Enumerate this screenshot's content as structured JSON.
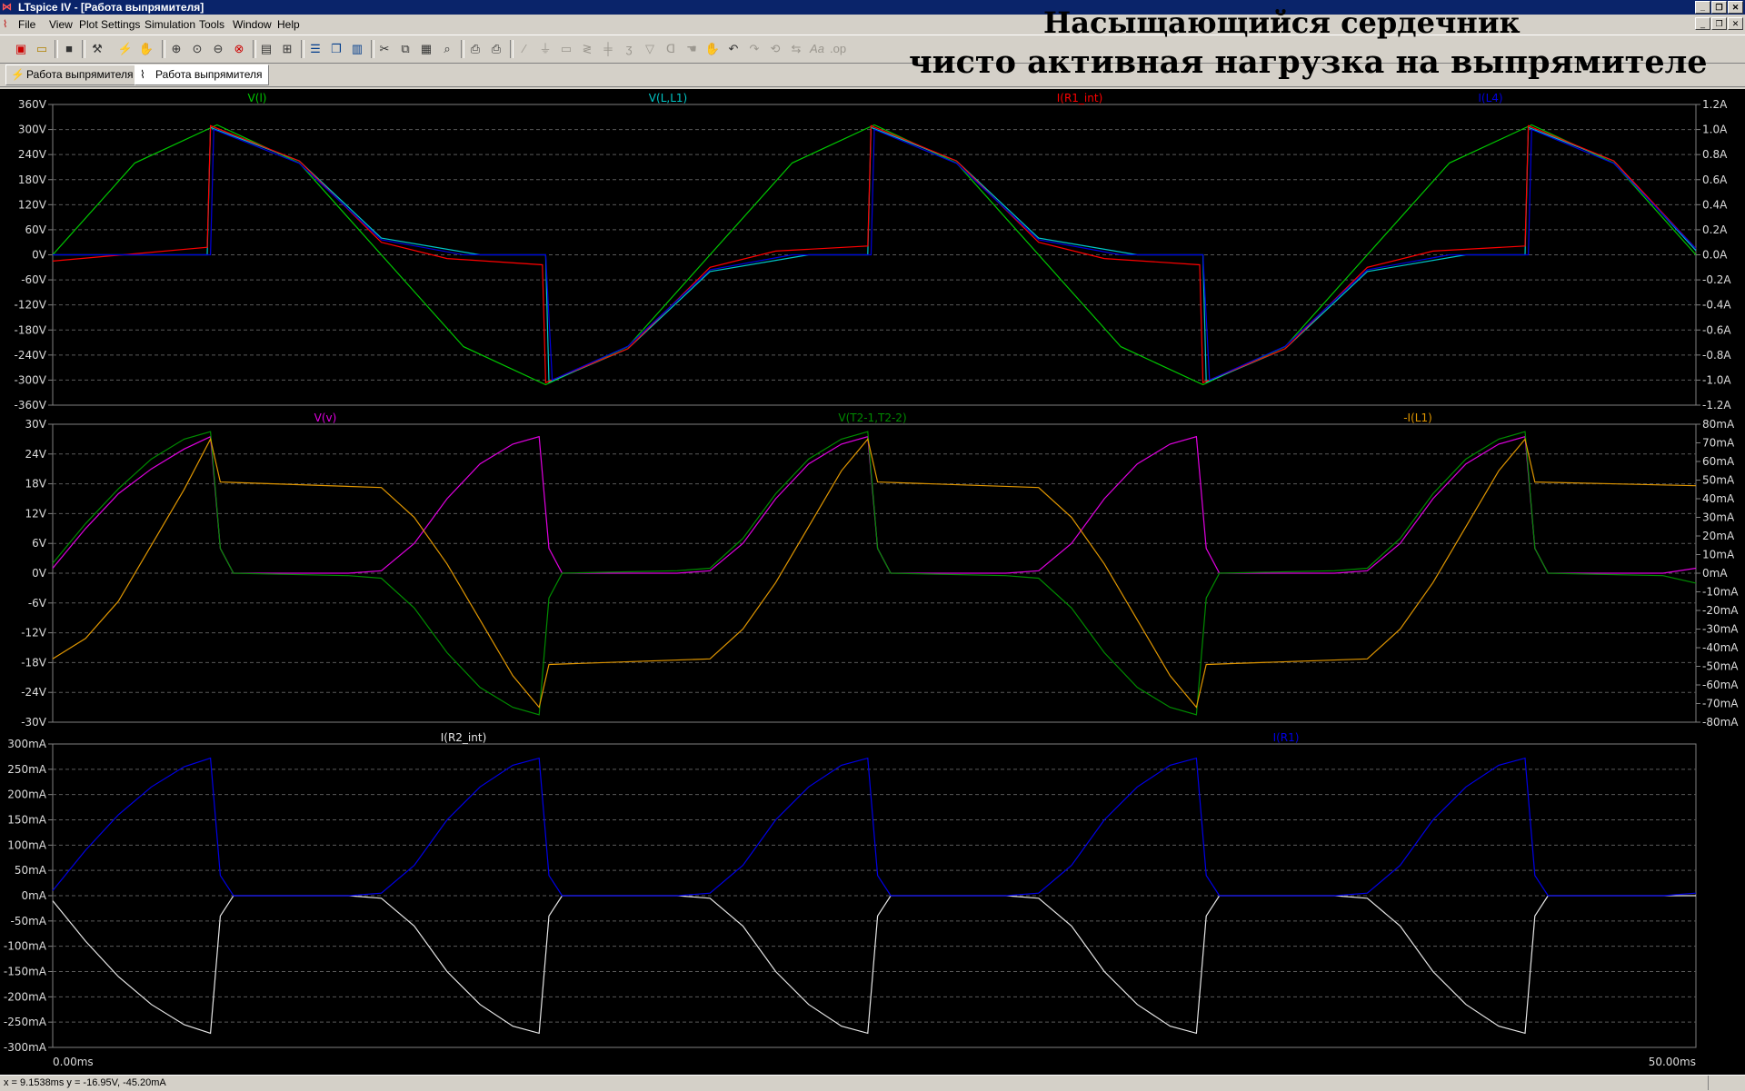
{
  "window": {
    "title": "LTspice IV - [Работа выпрямителя]",
    "min_label": "_",
    "restore_label": "❐",
    "close_label": "✕"
  },
  "menu": [
    "File",
    "View",
    "Plot Settings",
    "Simulation",
    "Tools",
    "Window",
    "Help"
  ],
  "toolbar_icons": [
    "open-schematic-icon",
    "open-file-icon",
    "save-icon",
    "control-panel-icon",
    "run-icon",
    "halt-icon",
    "zoom-in-icon",
    "zoom-area-icon",
    "zoom-out-icon",
    "zoom-cancel-icon",
    "autorange-icon",
    "fit-icon",
    "tile-horizontal-icon",
    "cascade-icon",
    "tile-vertical-icon",
    "cut-icon",
    "copy-icon",
    "paste-icon",
    "find-icon",
    "print-preview-icon",
    "print-icon",
    "wire-icon",
    "ground-icon",
    "label-icon",
    "resistor-icon",
    "capacitor-icon",
    "inductor-icon",
    "diode-icon",
    "component-icon",
    "move-icon",
    "drag-icon",
    "undo-icon",
    "redo-icon",
    "rotate-icon",
    "mirror-icon",
    "text-icon",
    "spice-directive-icon"
  ],
  "overlay_text": {
    "line1": "Насыщающийся сердечник",
    "line2": "чисто активная нагрузка на выпрямителе"
  },
  "tabs": [
    {
      "label": "Работа выпрямителя",
      "icon": "schematic-icon"
    },
    {
      "label": "Работа выпрямителя",
      "icon": "waveform-icon",
      "active": true
    }
  ],
  "status": "x = 9.1538ms   y = -16.95V, -45.20mA",
  "chart_data": [
    {
      "type": "line",
      "x_unit": "ms",
      "xlim": [
        0,
        50
      ],
      "x_tick_labels": [
        "0.00ms",
        "50.00ms"
      ],
      "ylim_left": [
        -360,
        360
      ],
      "y_left_unit": "V",
      "y_left_ticks": [
        "360V",
        "300V",
        "240V",
        "180V",
        "120V",
        "60V",
        "0V",
        "-60V",
        "-120V",
        "-180V",
        "-240V",
        "-300V",
        "-360V"
      ],
      "ylim_right": [
        -1.2,
        1.2
      ],
      "y_right_unit": "A",
      "y_right_ticks": [
        "1.2A",
        "1.0A",
        "0.8A",
        "0.6A",
        "0.4A",
        "0.2A",
        "0.0A",
        "-0.2A",
        "-0.4A",
        "-0.6A",
        "-0.8A",
        "-1.0A",
        "-1.2A"
      ],
      "grid": true,
      "series": [
        {
          "name": "V(l)",
          "color": "#00c800",
          "axis": "left",
          "x": [
            0,
            2.5,
            5,
            7.5,
            10,
            12.5,
            15,
            17.5,
            20,
            22.5,
            25,
            27.5,
            30,
            32.5,
            35,
            37.5,
            40,
            42.5,
            45,
            47.5,
            50
          ],
          "values": [
            0,
            220,
            311,
            220,
            0,
            -220,
            -311,
            -220,
            0,
            220,
            311,
            220,
            0,
            -220,
            -311,
            -220,
            0,
            220,
            311,
            220,
            0
          ]
        },
        {
          "name": "V(L,L1)",
          "color": "#00c8c8",
          "axis": "left",
          "x": [
            0,
            4.7,
            4.8,
            7.5,
            10,
            13,
            15,
            15.1,
            17.5,
            20,
            23,
            24.8,
            24.9,
            27.5,
            30,
            33,
            35,
            35.1,
            37.5,
            40,
            43,
            44.8,
            44.9,
            47.5,
            50
          ],
          "values": [
            0,
            0,
            305,
            225,
            40,
            0,
            0,
            -305,
            -225,
            -40,
            0,
            0,
            305,
            225,
            40,
            0,
            0,
            -305,
            -225,
            -40,
            0,
            0,
            305,
            225,
            10
          ]
        },
        {
          "name": "I(R1_int)",
          "color": "#ff0000",
          "axis": "right",
          "x": [
            0,
            4.7,
            4.8,
            7.5,
            10,
            12,
            14.9,
            15,
            17.5,
            20,
            22,
            24.8,
            24.9,
            27.5,
            30,
            32,
            34.9,
            35,
            37.5,
            40,
            42,
            44.8,
            44.9,
            47.5,
            50
          ],
          "values": [
            -0.05,
            0.06,
            1.03,
            0.75,
            0.1,
            -0.03,
            -0.08,
            -1.02,
            -0.75,
            -0.1,
            0.03,
            0.07,
            1.03,
            0.75,
            0.1,
            -0.03,
            -0.08,
            -1.02,
            -0.75,
            -0.1,
            0.03,
            0.07,
            1.03,
            0.75,
            0.05
          ]
        },
        {
          "name": "I(L4)",
          "color": "#0000e0",
          "axis": "right",
          "x": [
            0,
            4.8,
            4.9,
            7.5,
            10,
            12.5,
            15.0,
            15.2,
            17.5,
            20,
            22.5,
            24.9,
            25,
            27.5,
            30,
            32.5,
            35,
            35.2,
            37.5,
            40,
            42.5,
            44.9,
            45,
            47.5,
            50
          ],
          "values": [
            0,
            0,
            1.0,
            0.73,
            0.12,
            0,
            0,
            -1.0,
            -0.73,
            -0.12,
            0,
            0,
            1.0,
            0.73,
            0.12,
            0,
            0,
            -1.0,
            -0.73,
            -0.12,
            0,
            0,
            1.0,
            0.73,
            0.05
          ]
        }
      ]
    },
    {
      "type": "line",
      "x_unit": "ms",
      "xlim": [
        0,
        50
      ],
      "ylim_left": [
        -30,
        30
      ],
      "y_left_unit": "V",
      "y_left_ticks": [
        "30V",
        "24V",
        "18V",
        "12V",
        "6V",
        "0V",
        "-6V",
        "-12V",
        "-18V",
        "-24V",
        "-30V"
      ],
      "ylim_right": [
        -80,
        80
      ],
      "y_right_unit": "mA",
      "y_right_ticks": [
        "80mA",
        "70mA",
        "60mA",
        "50mA",
        "40mA",
        "30mA",
        "20mA",
        "10mA",
        "0mA",
        "-10mA",
        "-20mA",
        "-30mA",
        "-40mA",
        "-50mA",
        "-60mA",
        "-70mA",
        "-80mA"
      ],
      "grid": true,
      "series": [
        {
          "name": "V(v)",
          "color": "#e000e0",
          "axis": "left",
          "x": [
            0,
            1,
            2,
            3,
            4,
            4.8,
            5.1,
            5.5,
            9,
            10,
            11,
            12,
            13,
            14,
            14.8,
            15.1,
            15.5,
            19,
            20,
            21,
            22,
            23,
            24,
            24.8,
            25.1,
            25.5,
            29,
            30,
            31,
            32,
            33,
            34,
            34.8,
            35.1,
            35.5,
            39,
            40,
            41,
            42,
            43,
            44,
            44.8,
            45.1,
            45.5,
            49,
            50
          ],
          "values": [
            1,
            9,
            16,
            21,
            25,
            27.5,
            5,
            0,
            0,
            0.5,
            6,
            15,
            22,
            26,
            27.5,
            5,
            0,
            0,
            0.5,
            6,
            15,
            22,
            26,
            27.5,
            5,
            0,
            0,
            0.5,
            6,
            15,
            22,
            26,
            27.5,
            5,
            0,
            0,
            0.5,
            6,
            15,
            22,
            26,
            27.5,
            5,
            0,
            0,
            1
          ]
        },
        {
          "name": "V(T2-1,T2-2)",
          "color": "#008c00",
          "axis": "left",
          "x": [
            0,
            1,
            2,
            3,
            4,
            4.8,
            5.1,
            5.5,
            9,
            10,
            11,
            12,
            13,
            14,
            14.8,
            15.1,
            15.5,
            19,
            20,
            21,
            22,
            23,
            24,
            24.8,
            25.1,
            25.5,
            29,
            30,
            31,
            32,
            33,
            34,
            34.8,
            35.1,
            35.5,
            39,
            40,
            41,
            42,
            43,
            44,
            44.8,
            45.1,
            45.5,
            49,
            50
          ],
          "values": [
            2,
            10,
            17,
            23,
            27,
            28.5,
            5,
            0,
            -0.5,
            -1,
            -7,
            -16,
            -23,
            -27,
            -28.5,
            -5,
            0,
            0.5,
            1,
            7,
            16,
            23,
            27,
            28.5,
            5,
            0,
            -0.5,
            -1,
            -7,
            -16,
            -23,
            -27,
            -28.5,
            -5,
            0,
            0.5,
            1,
            7,
            16,
            23,
            27,
            28.5,
            5,
            0,
            -0.5,
            -2
          ]
        },
        {
          "name": "-I(L1)",
          "color": "#e09600",
          "axis": "right",
          "x": [
            0,
            1,
            2,
            3,
            4,
            4.8,
            5.1,
            10,
            11,
            12,
            13,
            14,
            14.8,
            15.1,
            20,
            21,
            22,
            23,
            24,
            24.8,
            25.1,
            30,
            31,
            32,
            33,
            34,
            34.8,
            35.1,
            40,
            41,
            42,
            43,
            44,
            44.8,
            45.1,
            50
          ],
          "values": [
            -46,
            -35,
            -15,
            15,
            45,
            72,
            49,
            46,
            30,
            5,
            -25,
            -55,
            -72,
            -49,
            -46,
            -30,
            -5,
            25,
            55,
            72,
            49,
            46,
            30,
            5,
            -25,
            -55,
            -72,
            -49,
            -46,
            -30,
            -5,
            25,
            55,
            72,
            49,
            47
          ]
        }
      ]
    },
    {
      "type": "line",
      "x_unit": "ms",
      "xlim": [
        0,
        50
      ],
      "ylim_left": [
        -300,
        300
      ],
      "y_left_unit": "mA",
      "y_left_ticks": [
        "300mA",
        "250mA",
        "200mA",
        "150mA",
        "100mA",
        "50mA",
        "0mA",
        "-50mA",
        "-100mA",
        "-150mA",
        "-200mA",
        "-250mA",
        "-300mA"
      ],
      "grid": true,
      "series": [
        {
          "name": "I(R2_int)",
          "color": "#e6e6e6",
          "axis": "left",
          "x": [
            0,
            1,
            2,
            3,
            4,
            4.8,
            5.1,
            5.5,
            9,
            10,
            11,
            12,
            13,
            14,
            14.8,
            15.1,
            15.5,
            19,
            20,
            21,
            22,
            23,
            24,
            24.8,
            25.1,
            25.5,
            29,
            30,
            31,
            32,
            33,
            34,
            34.8,
            35.1,
            35.5,
            39,
            40,
            41,
            42,
            43,
            44,
            44.8,
            45.1,
            45.5,
            49,
            50
          ],
          "values": [
            -10,
            -90,
            -160,
            -215,
            -255,
            -272,
            -40,
            0,
            0,
            -5,
            -60,
            -150,
            -215,
            -258,
            -272,
            -40,
            0,
            0,
            -5,
            -60,
            -150,
            -215,
            -258,
            -272,
            -40,
            0,
            0,
            -5,
            -60,
            -150,
            -215,
            -258,
            -272,
            -40,
            0,
            0,
            -5,
            -60,
            -150,
            -215,
            -258,
            -272,
            -40,
            0,
            0,
            0
          ]
        },
        {
          "name": "I(R1)",
          "color": "#0000e6",
          "axis": "left",
          "x": [
            0,
            1,
            2,
            3,
            4,
            4.8,
            5.1,
            5.5,
            9,
            10,
            11,
            12,
            13,
            14,
            14.8,
            15.1,
            15.5,
            19,
            20,
            21,
            22,
            23,
            24,
            24.8,
            25.1,
            25.5,
            29,
            30,
            31,
            32,
            33,
            34,
            34.8,
            35.1,
            35.5,
            39,
            40,
            41,
            42,
            43,
            44,
            44.8,
            45.1,
            45.5,
            49,
            50
          ],
          "values": [
            10,
            90,
            160,
            215,
            255,
            272,
            40,
            0,
            0,
            5,
            60,
            150,
            215,
            258,
            272,
            40,
            0,
            0,
            5,
            60,
            150,
            215,
            258,
            272,
            40,
            0,
            0,
            5,
            60,
            150,
            215,
            258,
            272,
            40,
            0,
            0,
            5,
            60,
            150,
            215,
            258,
            272,
            40,
            0,
            0,
            5
          ]
        }
      ]
    }
  ]
}
